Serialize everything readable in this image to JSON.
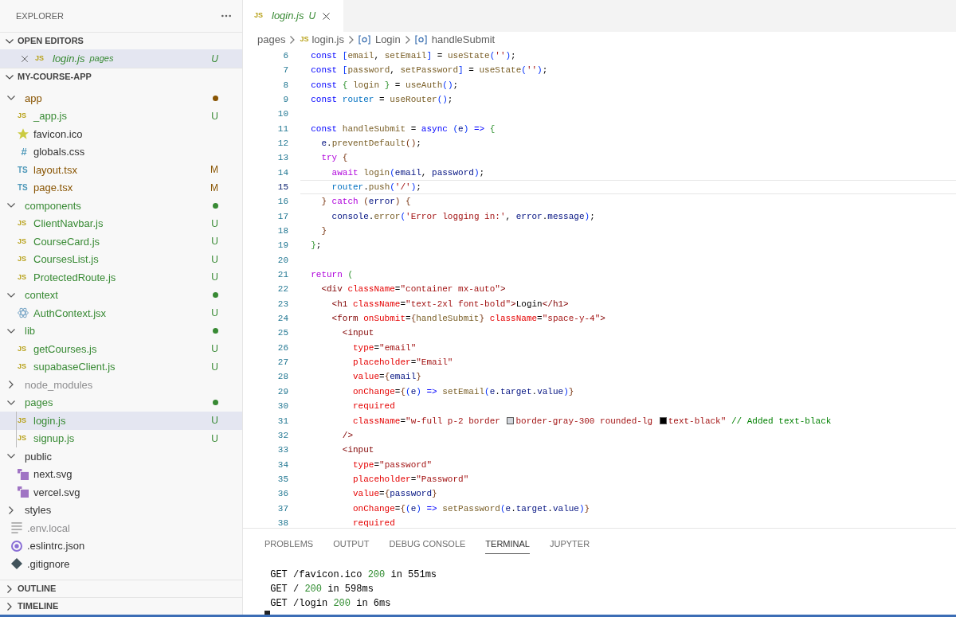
{
  "sidebar": {
    "title": "EXPLORER",
    "open_editors": {
      "title": "OPEN EDITORS",
      "expanded": true,
      "items": [
        {
          "icon": {
            "kind": "js",
            "label": "JS"
          },
          "name": "login.js",
          "description": "pages",
          "color": "#388a34",
          "badge": "U",
          "preview": true,
          "selected": true
        }
      ]
    },
    "project": {
      "title": "MY-COURSE-APP",
      "expanded": true,
      "items": [
        {
          "kind": "folder",
          "name": "app",
          "color": "#895503",
          "dot": true,
          "expanded": true,
          "children": [
            {
              "kind": "file",
              "icon": {
                "kind": "js",
                "label": "JS"
              },
              "name": "_app.js",
              "color": "#388a34",
              "badge": "U",
              "selected": false
            },
            {
              "kind": "file",
              "icon": {
                "kind": "star"
              },
              "name": "favicon.ico",
              "color": "#333333",
              "selected": false
            },
            {
              "kind": "file",
              "icon": {
                "kind": "hash",
                "label": "#"
              },
              "name": "globals.css",
              "color": "#333333",
              "selected": false
            },
            {
              "kind": "file",
              "icon": {
                "kind": "ts",
                "label": "TS"
              },
              "name": "layout.tsx",
              "color": "#895503",
              "badge": "M",
              "selected": false
            },
            {
              "kind": "file",
              "icon": {
                "kind": "ts",
                "label": "TS"
              },
              "name": "page.tsx",
              "color": "#895503",
              "badge": "M",
              "selected": false
            }
          ]
        },
        {
          "kind": "folder",
          "name": "components",
          "color": "#388a34",
          "dot": true,
          "expanded": true,
          "children": [
            {
              "kind": "file",
              "icon": {
                "kind": "js",
                "label": "JS"
              },
              "name": "ClientNavbar.js",
              "color": "#388a34",
              "badge": "U",
              "selected": false
            },
            {
              "kind": "file",
              "icon": {
                "kind": "js",
                "label": "JS"
              },
              "name": "CourseCard.js",
              "color": "#388a34",
              "badge": "U",
              "selected": false
            },
            {
              "kind": "file",
              "icon": {
                "kind": "js",
                "label": "JS"
              },
              "name": "CoursesList.js",
              "color": "#388a34",
              "badge": "U",
              "selected": false
            },
            {
              "kind": "file",
              "icon": {
                "kind": "js",
                "label": "JS"
              },
              "name": "ProtectedRoute.js",
              "color": "#388a34",
              "badge": "U",
              "selected": false
            }
          ]
        },
        {
          "kind": "folder",
          "name": "context",
          "color": "#388a34",
          "dot": true,
          "expanded": true,
          "children": [
            {
              "kind": "file",
              "icon": {
                "kind": "react"
              },
              "name": "AuthContext.jsx",
              "color": "#388a34",
              "badge": "U",
              "selected": false
            }
          ]
        },
        {
          "kind": "folder",
          "name": "lib",
          "color": "#388a34",
          "dot": true,
          "expanded": true,
          "children": [
            {
              "kind": "file",
              "icon": {
                "kind": "js",
                "label": "JS"
              },
              "name": "getCourses.js",
              "color": "#388a34",
              "badge": "U",
              "selected": false
            },
            {
              "kind": "file",
              "icon": {
                "kind": "js",
                "label": "JS"
              },
              "name": "supabaseClient.js",
              "color": "#388a34",
              "badge": "U",
              "selected": false
            }
          ]
        },
        {
          "kind": "folder",
          "name": "node_modules",
          "color": "#8e8e90",
          "expanded": false
        },
        {
          "kind": "folder",
          "name": "pages",
          "color": "#388a34",
          "dot": true,
          "expanded": true,
          "children": [
            {
              "kind": "file",
              "icon": {
                "kind": "js",
                "label": "JS"
              },
              "name": "login.js",
              "color": "#388a34",
              "badge": "U",
              "selected": true
            },
            {
              "kind": "file",
              "icon": {
                "kind": "js",
                "label": "JS"
              },
              "name": "signup.js",
              "color": "#388a34",
              "badge": "U",
              "selected": false
            }
          ]
        },
        {
          "kind": "folder",
          "name": "public",
          "color": "#333333",
          "expanded": true,
          "children": [
            {
              "kind": "file",
              "icon": {
                "kind": "svg"
              },
              "name": "next.svg",
              "color": "#333333",
              "selected": false
            },
            {
              "kind": "file",
              "icon": {
                "kind": "svg"
              },
              "name": "vercel.svg",
              "color": "#333333",
              "selected": false
            }
          ]
        },
        {
          "kind": "folder",
          "name": "styles",
          "color": "#333333",
          "expanded": false
        },
        {
          "kind": "file",
          "icon": {
            "kind": "lines"
          },
          "name": ".env.local",
          "color": "#8e8e90",
          "selected": false
        },
        {
          "kind": "file",
          "icon": {
            "kind": "eslint"
          },
          "name": ".eslintrc.json",
          "color": "#333333",
          "selected": false
        },
        {
          "kind": "file",
          "icon": {
            "kind": "git"
          },
          "name": ".gitignore",
          "color": "#333333",
          "selected": false
        }
      ]
    },
    "sections": [
      {
        "title": "OUTLINE",
        "expanded": false
      },
      {
        "title": "TIMELINE",
        "expanded": false
      }
    ]
  },
  "editor": {
    "tabs": [
      {
        "icon": {
          "kind": "js",
          "label": "JS"
        },
        "title": "login.js",
        "badge": "U",
        "color": "#388a34",
        "preview": true,
        "selected": true
      }
    ],
    "breadcrumbs": [
      {
        "kind": "folder",
        "text": "pages"
      },
      {
        "kind": "file",
        "label": "JS",
        "text": "login.js"
      },
      {
        "kind": "symbol",
        "text": "Login"
      },
      {
        "kind": "symbol",
        "text": "handleSubmit"
      }
    ],
    "lines": [
      {
        "number": "6",
        "current": false,
        "tokens": [
          {
            "kind": "kw",
            "text": "  const "
          },
          {
            "kind": "b1",
            "text": "["
          },
          {
            "kind": "fn",
            "text": "email"
          },
          {
            "kind": "p",
            "text": ", "
          },
          {
            "kind": "fn",
            "text": "setEmail"
          },
          {
            "kind": "b1",
            "text": "]"
          },
          {
            "kind": "p",
            "text": " = "
          },
          {
            "kind": "fn",
            "text": "useState"
          },
          {
            "kind": "b1",
            "text": "("
          },
          {
            "kind": "str",
            "text": "''"
          },
          {
            "kind": "b1",
            "text": ")"
          },
          {
            "kind": "p",
            "text": ";"
          }
        ]
      },
      {
        "number": "7",
        "current": false,
        "tokens": [
          {
            "kind": "kw",
            "text": "  const "
          },
          {
            "kind": "b1",
            "text": "["
          },
          {
            "kind": "fn",
            "text": "password"
          },
          {
            "kind": "p",
            "text": ", "
          },
          {
            "kind": "fn",
            "text": "setPassword"
          },
          {
            "kind": "b1",
            "text": "]"
          },
          {
            "kind": "p",
            "text": " = "
          },
          {
            "kind": "fn",
            "text": "useState"
          },
          {
            "kind": "b1",
            "text": "("
          },
          {
            "kind": "str",
            "text": "''"
          },
          {
            "kind": "b1",
            "text": ")"
          },
          {
            "kind": "p",
            "text": ";"
          }
        ]
      },
      {
        "number": "8",
        "current": false,
        "tokens": [
          {
            "kind": "kw",
            "text": "  const "
          },
          {
            "kind": "b2",
            "text": "{"
          },
          {
            "kind": "fn",
            "text": " login "
          },
          {
            "kind": "b2",
            "text": "}"
          },
          {
            "kind": "p",
            "text": " = "
          },
          {
            "kind": "fn",
            "text": "useAuth"
          },
          {
            "kind": "b1",
            "text": "()"
          },
          {
            "kind": "p",
            "text": ";"
          }
        ]
      },
      {
        "number": "9",
        "current": false,
        "tokens": [
          {
            "kind": "kw",
            "text": "  const "
          },
          {
            "kind": "const",
            "text": "router"
          },
          {
            "kind": "p",
            "text": " = "
          },
          {
            "kind": "fn",
            "text": "useRouter"
          },
          {
            "kind": "b1",
            "text": "()"
          },
          {
            "kind": "p",
            "text": ";"
          }
        ]
      },
      {
        "number": "10",
        "current": false
      },
      {
        "number": "11",
        "current": false,
        "tokens": [
          {
            "kind": "kw",
            "text": "  const "
          },
          {
            "kind": "fn",
            "text": "handleSubmit"
          },
          {
            "kind": "p",
            "text": " = "
          },
          {
            "kind": "kw",
            "text": "async "
          },
          {
            "kind": "b1",
            "text": "("
          },
          {
            "kind": "var",
            "text": "e"
          },
          {
            "kind": "b1",
            "text": ")"
          },
          {
            "kind": "kw",
            "text": " => "
          },
          {
            "kind": "b2",
            "text": "{"
          }
        ]
      },
      {
        "number": "12",
        "current": false,
        "tokens": [
          {
            "kind": "var",
            "text": "    e"
          },
          {
            "kind": "p",
            "text": "."
          },
          {
            "kind": "fn",
            "text": "preventDefault"
          },
          {
            "kind": "b3",
            "text": "()"
          },
          {
            "kind": "p",
            "text": ";"
          }
        ]
      },
      {
        "number": "13",
        "current": false,
        "tokens": [
          {
            "kind": "ctl",
            "text": "    try "
          },
          {
            "kind": "b3",
            "text": "{"
          }
        ]
      },
      {
        "number": "14",
        "current": false,
        "tokens": [
          {
            "kind": "ctl",
            "text": "      await "
          },
          {
            "kind": "fn",
            "text": "login"
          },
          {
            "kind": "b1",
            "text": "("
          },
          {
            "kind": "var",
            "text": "email"
          },
          {
            "kind": "p",
            "text": ", "
          },
          {
            "kind": "var",
            "text": "password"
          },
          {
            "kind": "b1",
            "text": ")"
          },
          {
            "kind": "p",
            "text": ";"
          }
        ]
      },
      {
        "number": "15",
        "current": true,
        "tokens": [
          {
            "kind": "const",
            "text": "      router"
          },
          {
            "kind": "p",
            "text": "."
          },
          {
            "kind": "fn",
            "text": "push"
          },
          {
            "kind": "b1",
            "text": "("
          },
          {
            "kind": "str",
            "text": "'/'"
          },
          {
            "kind": "b1",
            "text": ")"
          },
          {
            "kind": "p",
            "text": ";"
          }
        ]
      },
      {
        "number": "16",
        "current": false,
        "tokens": [
          {
            "kind": "b3",
            "text": "    }"
          },
          {
            "kind": "ctl",
            "text": " catch "
          },
          {
            "kind": "b3",
            "text": "("
          },
          {
            "kind": "var",
            "text": "error"
          },
          {
            "kind": "b3",
            "text": ")"
          },
          {
            "kind": "b3",
            "text": " {"
          }
        ]
      },
      {
        "number": "17",
        "current": false,
        "tokens": [
          {
            "kind": "var",
            "text": "      console"
          },
          {
            "kind": "p",
            "text": "."
          },
          {
            "kind": "fn",
            "text": "error"
          },
          {
            "kind": "b1",
            "text": "("
          },
          {
            "kind": "str",
            "text": "'Error logging in:'"
          },
          {
            "kind": "p",
            "text": ", "
          },
          {
            "kind": "var",
            "text": "error"
          },
          {
            "kind": "p",
            "text": "."
          },
          {
            "kind": "var",
            "text": "message"
          },
          {
            "kind": "b1",
            "text": ")"
          },
          {
            "kind": "p",
            "text": ";"
          }
        ]
      },
      {
        "number": "18",
        "current": false,
        "tokens": [
          {
            "kind": "b3",
            "text": "    }"
          }
        ]
      },
      {
        "number": "19",
        "current": false,
        "tokens": [
          {
            "kind": "b2",
            "text": "  }"
          },
          {
            "kind": "p",
            "text": ";"
          }
        ]
      },
      {
        "number": "20",
        "current": false
      },
      {
        "number": "21",
        "current": false,
        "tokens": [
          {
            "kind": "ctl",
            "text": "  return "
          },
          {
            "kind": "b2",
            "text": "("
          }
        ]
      },
      {
        "number": "22",
        "current": false,
        "tokens": [
          {
            "kind": "tag",
            "text": "    <div "
          },
          {
            "kind": "attr",
            "text": "className"
          },
          {
            "kind": "p",
            "text": "="
          },
          {
            "kind": "str",
            "text": "\"container mx-auto\""
          },
          {
            "kind": "tag",
            "text": ">"
          }
        ]
      },
      {
        "number": "23",
        "current": false,
        "tokens": [
          {
            "kind": "tag",
            "text": "      <h1 "
          },
          {
            "kind": "attr",
            "text": "className"
          },
          {
            "kind": "p",
            "text": "="
          },
          {
            "kind": "str",
            "text": "\"text-2xl font-bold\""
          },
          {
            "kind": "tag",
            "text": ">"
          },
          {
            "kind": "p",
            "text": "Login"
          },
          {
            "kind": "tag",
            "text": "</h1>"
          }
        ]
      },
      {
        "number": "24",
        "current": false,
        "tokens": [
          {
            "kind": "tag",
            "text": "      <form "
          },
          {
            "kind": "attr",
            "text": "onSubmit"
          },
          {
            "kind": "p",
            "text": "="
          },
          {
            "kind": "b3",
            "text": "{"
          },
          {
            "kind": "fn",
            "text": "handleSubmit"
          },
          {
            "kind": "b3",
            "text": "}"
          },
          {
            "kind": "attr",
            "text": " className"
          },
          {
            "kind": "p",
            "text": "="
          },
          {
            "kind": "str",
            "text": "\"space-y-4\""
          },
          {
            "kind": "tag",
            "text": ">"
          }
        ]
      },
      {
        "number": "25",
        "current": false,
        "tokens": [
          {
            "kind": "tag",
            "text": "        <input"
          }
        ]
      },
      {
        "number": "26",
        "current": false,
        "tokens": [
          {
            "kind": "attr",
            "text": "          type"
          },
          {
            "kind": "p",
            "text": "="
          },
          {
            "kind": "str",
            "text": "\"email\""
          }
        ]
      },
      {
        "number": "27",
        "current": false,
        "tokens": [
          {
            "kind": "attr",
            "text": "          placeholder"
          },
          {
            "kind": "p",
            "text": "="
          },
          {
            "kind": "str",
            "text": "\"Email\""
          }
        ]
      },
      {
        "number": "28",
        "current": false,
        "tokens": [
          {
            "kind": "attr",
            "text": "          value"
          },
          {
            "kind": "p",
            "text": "="
          },
          {
            "kind": "b3",
            "text": "{"
          },
          {
            "kind": "var",
            "text": "email"
          },
          {
            "kind": "b3",
            "text": "}"
          }
        ]
      },
      {
        "number": "29",
        "current": false,
        "tokens": [
          {
            "kind": "attr",
            "text": "          onChange"
          },
          {
            "kind": "p",
            "text": "="
          },
          {
            "kind": "b3",
            "text": "{"
          },
          {
            "kind": "b1",
            "text": "("
          },
          {
            "kind": "var",
            "text": "e"
          },
          {
            "kind": "b1",
            "text": ")"
          },
          {
            "kind": "kw",
            "text": " => "
          },
          {
            "kind": "fn",
            "text": "setEmail"
          },
          {
            "kind": "b1",
            "text": "("
          },
          {
            "kind": "var",
            "text": "e"
          },
          {
            "kind": "p",
            "text": "."
          },
          {
            "kind": "var",
            "text": "target"
          },
          {
            "kind": "p",
            "text": "."
          },
          {
            "kind": "var",
            "text": "value"
          },
          {
            "kind": "b1",
            "text": ")"
          },
          {
            "kind": "b3",
            "text": "}"
          }
        ]
      },
      {
        "number": "30",
        "current": false,
        "tokens": [
          {
            "kind": "attr",
            "text": "          required"
          }
        ]
      },
      {
        "number": "31",
        "current": false,
        "tokens": [
          {
            "kind": "attr",
            "text": "          className"
          },
          {
            "kind": "p",
            "text": "="
          },
          {
            "kind": "str",
            "text": "\"w-full p-2 border "
          },
          {
            "kind": "swatch",
            "color": "#d1d5db"
          },
          {
            "kind": "str",
            "text": "border-gray-300 rounded-lg "
          },
          {
            "kind": "swatch",
            "color": "#000000"
          },
          {
            "kind": "str",
            "text": "text-black\""
          },
          {
            "kind": "cmt",
            "text": " // Added text-black"
          }
        ]
      },
      {
        "number": "32",
        "current": false,
        "tokens": [
          {
            "kind": "tag",
            "text": "        />"
          }
        ]
      },
      {
        "number": "33",
        "current": false,
        "tokens": [
          {
            "kind": "tag",
            "text": "        <input"
          }
        ]
      },
      {
        "number": "34",
        "current": false,
        "tokens": [
          {
            "kind": "attr",
            "text": "          type"
          },
          {
            "kind": "p",
            "text": "="
          },
          {
            "kind": "str",
            "text": "\"password\""
          }
        ]
      },
      {
        "number": "35",
        "current": false,
        "tokens": [
          {
            "kind": "attr",
            "text": "          placeholder"
          },
          {
            "kind": "p",
            "text": "="
          },
          {
            "kind": "str",
            "text": "\"Password\""
          }
        ]
      },
      {
        "number": "36",
        "current": false,
        "tokens": [
          {
            "kind": "attr",
            "text": "          value"
          },
          {
            "kind": "p",
            "text": "="
          },
          {
            "kind": "b3",
            "text": "{"
          },
          {
            "kind": "var",
            "text": "password"
          },
          {
            "kind": "b3",
            "text": "}"
          }
        ]
      },
      {
        "number": "37",
        "current": false,
        "tokens": [
          {
            "kind": "attr",
            "text": "          onChange"
          },
          {
            "kind": "p",
            "text": "="
          },
          {
            "kind": "b3",
            "text": "{"
          },
          {
            "kind": "b1",
            "text": "("
          },
          {
            "kind": "var",
            "text": "e"
          },
          {
            "kind": "b1",
            "text": ")"
          },
          {
            "kind": "kw",
            "text": " => "
          },
          {
            "kind": "fn",
            "text": "setPassword"
          },
          {
            "kind": "b1",
            "text": "("
          },
          {
            "kind": "var",
            "text": "e"
          },
          {
            "kind": "p",
            "text": "."
          },
          {
            "kind": "var",
            "text": "target"
          },
          {
            "kind": "p",
            "text": "."
          },
          {
            "kind": "var",
            "text": "value"
          },
          {
            "kind": "b1",
            "text": ")"
          },
          {
            "kind": "b3",
            "text": "}"
          }
        ]
      },
      {
        "number": "38",
        "current": false,
        "tokens": [
          {
            "kind": "attr",
            "text": "          required"
          }
        ]
      }
    ]
  },
  "panel": {
    "tabs": [
      {
        "label": "PROBLEMS",
        "selected": false
      },
      {
        "label": "OUTPUT",
        "selected": false
      },
      {
        "label": "DEBUG CONSOLE",
        "selected": false
      },
      {
        "label": "TERMINAL",
        "selected": true
      },
      {
        "label": "JUPYTER",
        "selected": false
      }
    ],
    "terminal_lines": [
      [
        {
          "kind": "p",
          "text": " GET /favicon.ico "
        },
        {
          "kind": "ok",
          "text": "200"
        },
        {
          "kind": "p",
          "text": " in 551ms"
        }
      ],
      [
        {
          "kind": "p",
          "text": " GET / "
        },
        {
          "kind": "ok",
          "text": "200"
        },
        {
          "kind": "p",
          "text": " in 598ms"
        }
      ],
      [
        {
          "kind": "p",
          "text": " GET /login "
        },
        {
          "kind": "ok",
          "text": "200"
        },
        {
          "kind": "p",
          "text": " in 6ms"
        }
      ]
    ]
  }
}
